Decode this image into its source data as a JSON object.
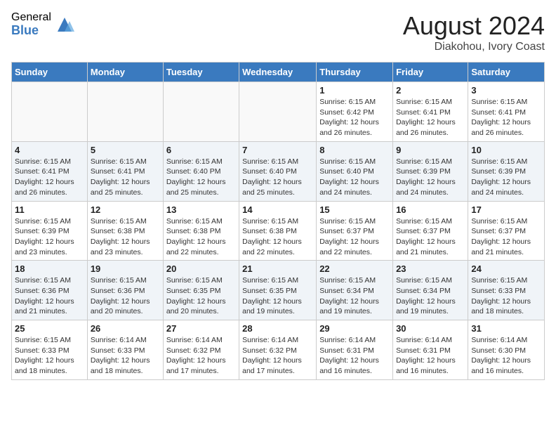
{
  "header": {
    "logo_general": "General",
    "logo_blue": "Blue",
    "month_year": "August 2024",
    "location": "Diakohou, Ivory Coast"
  },
  "weekdays": [
    "Sunday",
    "Monday",
    "Tuesday",
    "Wednesday",
    "Thursday",
    "Friday",
    "Saturday"
  ],
  "weeks": [
    [
      {
        "day": "",
        "info": ""
      },
      {
        "day": "",
        "info": ""
      },
      {
        "day": "",
        "info": ""
      },
      {
        "day": "",
        "info": ""
      },
      {
        "day": "1",
        "info": "Sunrise: 6:15 AM\nSunset: 6:42 PM\nDaylight: 12 hours\nand 26 minutes."
      },
      {
        "day": "2",
        "info": "Sunrise: 6:15 AM\nSunset: 6:41 PM\nDaylight: 12 hours\nand 26 minutes."
      },
      {
        "day": "3",
        "info": "Sunrise: 6:15 AM\nSunset: 6:41 PM\nDaylight: 12 hours\nand 26 minutes."
      }
    ],
    [
      {
        "day": "4",
        "info": "Sunrise: 6:15 AM\nSunset: 6:41 PM\nDaylight: 12 hours\nand 26 minutes."
      },
      {
        "day": "5",
        "info": "Sunrise: 6:15 AM\nSunset: 6:41 PM\nDaylight: 12 hours\nand 25 minutes."
      },
      {
        "day": "6",
        "info": "Sunrise: 6:15 AM\nSunset: 6:40 PM\nDaylight: 12 hours\nand 25 minutes."
      },
      {
        "day": "7",
        "info": "Sunrise: 6:15 AM\nSunset: 6:40 PM\nDaylight: 12 hours\nand 25 minutes."
      },
      {
        "day": "8",
        "info": "Sunrise: 6:15 AM\nSunset: 6:40 PM\nDaylight: 12 hours\nand 24 minutes."
      },
      {
        "day": "9",
        "info": "Sunrise: 6:15 AM\nSunset: 6:39 PM\nDaylight: 12 hours\nand 24 minutes."
      },
      {
        "day": "10",
        "info": "Sunrise: 6:15 AM\nSunset: 6:39 PM\nDaylight: 12 hours\nand 24 minutes."
      }
    ],
    [
      {
        "day": "11",
        "info": "Sunrise: 6:15 AM\nSunset: 6:39 PM\nDaylight: 12 hours\nand 23 minutes."
      },
      {
        "day": "12",
        "info": "Sunrise: 6:15 AM\nSunset: 6:38 PM\nDaylight: 12 hours\nand 23 minutes."
      },
      {
        "day": "13",
        "info": "Sunrise: 6:15 AM\nSunset: 6:38 PM\nDaylight: 12 hours\nand 22 minutes."
      },
      {
        "day": "14",
        "info": "Sunrise: 6:15 AM\nSunset: 6:38 PM\nDaylight: 12 hours\nand 22 minutes."
      },
      {
        "day": "15",
        "info": "Sunrise: 6:15 AM\nSunset: 6:37 PM\nDaylight: 12 hours\nand 22 minutes."
      },
      {
        "day": "16",
        "info": "Sunrise: 6:15 AM\nSunset: 6:37 PM\nDaylight: 12 hours\nand 21 minutes."
      },
      {
        "day": "17",
        "info": "Sunrise: 6:15 AM\nSunset: 6:37 PM\nDaylight: 12 hours\nand 21 minutes."
      }
    ],
    [
      {
        "day": "18",
        "info": "Sunrise: 6:15 AM\nSunset: 6:36 PM\nDaylight: 12 hours\nand 21 minutes."
      },
      {
        "day": "19",
        "info": "Sunrise: 6:15 AM\nSunset: 6:36 PM\nDaylight: 12 hours\nand 20 minutes."
      },
      {
        "day": "20",
        "info": "Sunrise: 6:15 AM\nSunset: 6:35 PM\nDaylight: 12 hours\nand 20 minutes."
      },
      {
        "day": "21",
        "info": "Sunrise: 6:15 AM\nSunset: 6:35 PM\nDaylight: 12 hours\nand 19 minutes."
      },
      {
        "day": "22",
        "info": "Sunrise: 6:15 AM\nSunset: 6:34 PM\nDaylight: 12 hours\nand 19 minutes."
      },
      {
        "day": "23",
        "info": "Sunrise: 6:15 AM\nSunset: 6:34 PM\nDaylight: 12 hours\nand 19 minutes."
      },
      {
        "day": "24",
        "info": "Sunrise: 6:15 AM\nSunset: 6:33 PM\nDaylight: 12 hours\nand 18 minutes."
      }
    ],
    [
      {
        "day": "25",
        "info": "Sunrise: 6:15 AM\nSunset: 6:33 PM\nDaylight: 12 hours\nand 18 minutes."
      },
      {
        "day": "26",
        "info": "Sunrise: 6:14 AM\nSunset: 6:33 PM\nDaylight: 12 hours\nand 18 minutes."
      },
      {
        "day": "27",
        "info": "Sunrise: 6:14 AM\nSunset: 6:32 PM\nDaylight: 12 hours\nand 17 minutes."
      },
      {
        "day": "28",
        "info": "Sunrise: 6:14 AM\nSunset: 6:32 PM\nDaylight: 12 hours\nand 17 minutes."
      },
      {
        "day": "29",
        "info": "Sunrise: 6:14 AM\nSunset: 6:31 PM\nDaylight: 12 hours\nand 16 minutes."
      },
      {
        "day": "30",
        "info": "Sunrise: 6:14 AM\nSunset: 6:31 PM\nDaylight: 12 hours\nand 16 minutes."
      },
      {
        "day": "31",
        "info": "Sunrise: 6:14 AM\nSunset: 6:30 PM\nDaylight: 12 hours\nand 16 minutes."
      }
    ]
  ]
}
